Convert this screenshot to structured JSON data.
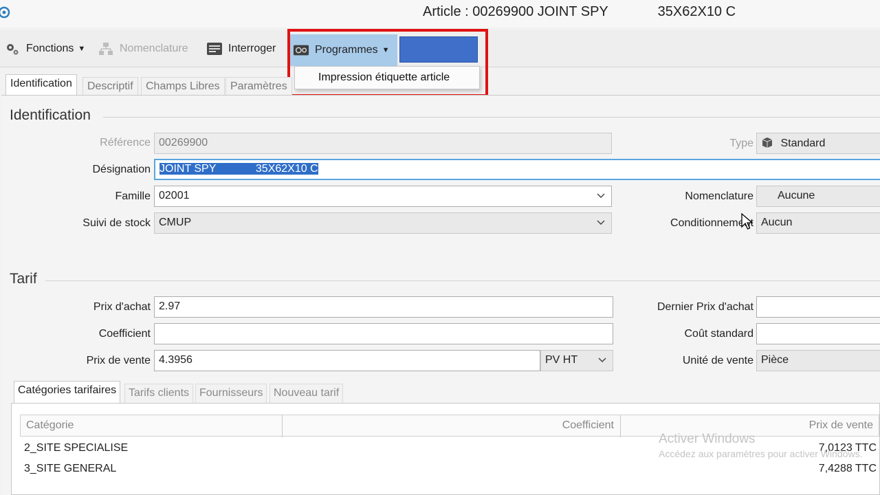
{
  "window": {
    "title": "Article : 00269900 JOINT SPY             35X62X10 C"
  },
  "toolbar": {
    "fonctions_label": "Fonctions",
    "nomenclature_label": "Nomenclature",
    "interroger_label": "Interroger",
    "programmes_label": "Programmes"
  },
  "programmes_menu": {
    "items": [
      "Impression étiquette article"
    ]
  },
  "tabs": [
    "Identification",
    "Descriptif",
    "Champs Libres",
    "Paramètres"
  ],
  "identification": {
    "section_title": "Identification",
    "reference_label": "Référence",
    "reference_value": "00269900",
    "designation_label": "Désignation",
    "designation_value": "JOINT SPY             35X62X10 C",
    "famille_label": "Famille",
    "famille_value": "02001",
    "suivi_label": "Suivi de stock",
    "suivi_value": "CMUP",
    "type_label": "Type",
    "type_value": "Standard",
    "nomenclature_label": "Nomenclature",
    "nomenclature_value": "Aucune",
    "conditionnement_label": "Conditionnement",
    "conditionnement_value": "Aucun"
  },
  "tarif": {
    "section_title": "Tarif",
    "prix_achat_label": "Prix d'achat",
    "prix_achat_value": "2.97",
    "coefficient_label": "Coefficient",
    "coefficient_value": "",
    "prix_vente_label": "Prix de vente",
    "prix_vente_value": "4.3956",
    "prix_vente_mode": "PV HT",
    "dernier_prix_label": "Dernier Prix d'achat",
    "dernier_prix_value": "",
    "cout_standard_label": "Coût standard",
    "cout_standard_value": "",
    "unite_vente_label": "Unité de vente",
    "unite_vente_value": "Pièce"
  },
  "subtabs": [
    "Catégories tarifaires",
    "Tarifs clients",
    "Fournisseurs",
    "Nouveau tarif"
  ],
  "grid": {
    "columns": [
      "Catégorie",
      "Coefficient",
      "Prix de vente"
    ],
    "rows": [
      {
        "categorie": "2_SITE SPECIALISE",
        "coefficient": "",
        "prix": "7,0123 TTC"
      },
      {
        "categorie": "3_SITE GENERAL",
        "coefficient": "",
        "prix": "7,4288 TTC"
      }
    ]
  },
  "watermark": {
    "line1": "Activer Windows",
    "line2": "Accédez aux paramètres pour activer Windows."
  },
  "colors": {
    "highlight_frame": "#e01212",
    "menu_active": "#a8cbea",
    "selection": "#2f6ec8",
    "focus_border": "#58a6df"
  }
}
